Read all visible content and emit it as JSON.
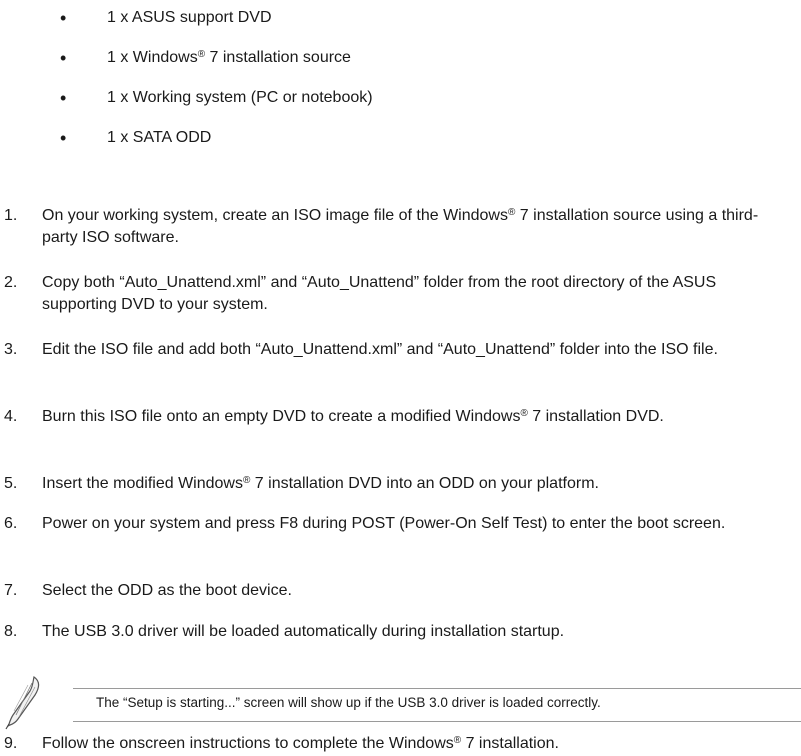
{
  "requirements": [
    "1 x ASUS support DVD",
    "1 x Windows",
    "1 x Working system (PC or notebook)",
    "1 x SATA ODD"
  ],
  "requirement_win7_suffix": " 7 installation source",
  "reg_mark": "®",
  "steps": [
    {
      "num": "1.",
      "a": "On your working system, create an ISO image file of the Windows",
      "b": " 7 installation source using a third-party ISO software."
    },
    {
      "num": "2.",
      "a": "Copy both “Auto_Unattend.xml” and “Auto_Unattend” folder from the root directory of the ASUS supporting DVD to your system."
    },
    {
      "num": "3.",
      "a": "Edit the ISO file and add both “Auto_Unattend.xml” and “Auto_Unattend” folder into the ISO file."
    },
    {
      "num": "4.",
      "a": "Burn this ISO file onto an empty DVD to create a modified Windows",
      "b": " 7 installation DVD."
    },
    {
      "num": "5.",
      "a": "Insert the modified Windows",
      "b": " 7 installation DVD into an ODD on your platform."
    },
    {
      "num": "6.",
      "a": "Power on your system and press F8 during POST (Power-On Self Test) to enter the boot screen."
    },
    {
      "num": "7.",
      "a": "Select the ODD as the boot device."
    },
    {
      "num": "8.",
      "a": "The USB 3.0 driver will be loaded automatically during installation startup."
    },
    {
      "num": "9.",
      "a": "Follow the onscreen instructions to complete the Windows",
      "b": " 7 installation."
    }
  ],
  "note": {
    "text": "The “Setup is starting...” screen will show up if the USB 3.0 driver is loaded correctly.",
    "icon": "pen-nib-icon"
  }
}
